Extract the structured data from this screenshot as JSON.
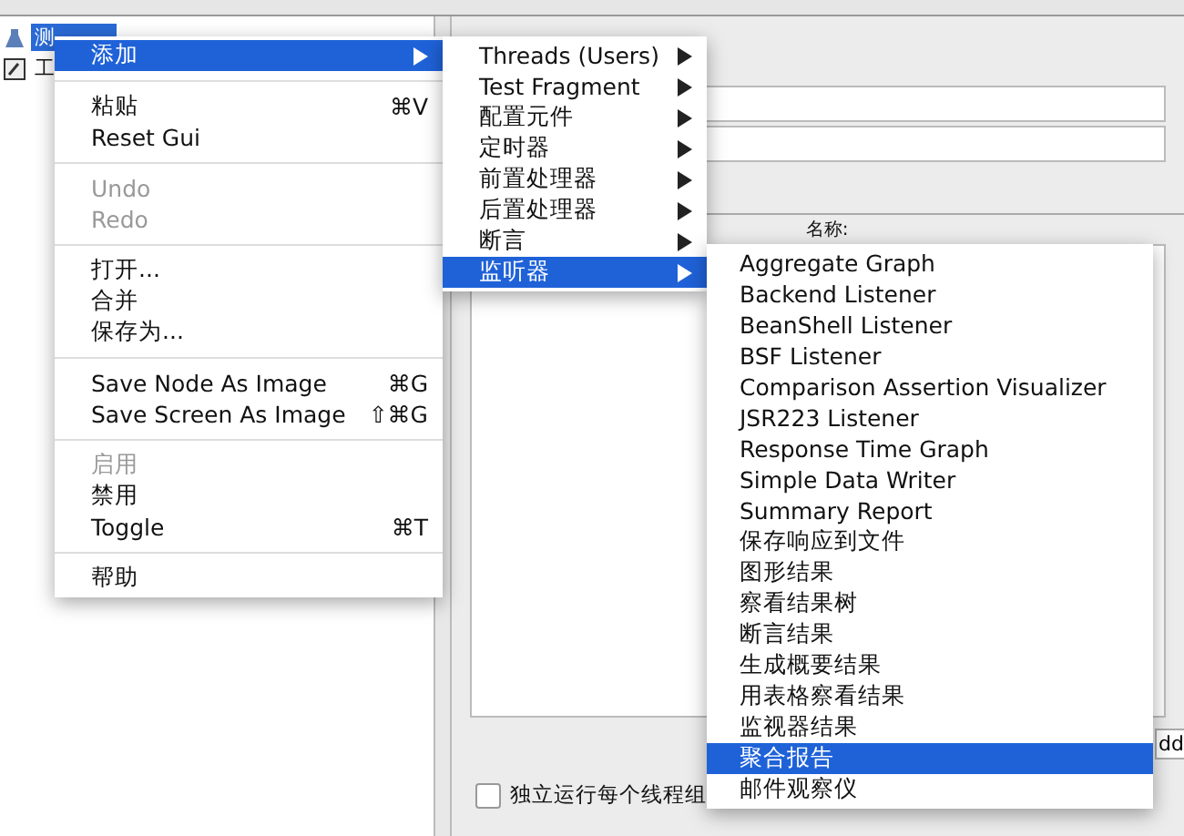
{
  "tree": [
    {
      "label": "测",
      "selected": true
    },
    {
      "label": "工",
      "selected": false
    }
  ],
  "panel": {
    "name_label": "名称:",
    "checkbox": {
      "label": "独立运行每个线程组",
      "checked": false
    },
    "button_fragment": "dd"
  },
  "context_menu": {
    "groups": [
      [
        {
          "label": "添加",
          "disabled": false,
          "selected": true,
          "submenu": true
        }
      ],
      [
        {
          "label": "粘贴",
          "shortcut": "⌘V",
          "disabled": false,
          "selected": false,
          "submenu": false
        },
        {
          "label": "Reset Gui",
          "disabled": false,
          "selected": false,
          "submenu": false
        }
      ],
      [
        {
          "label": "Undo",
          "disabled": true,
          "selected": false,
          "submenu": false
        },
        {
          "label": "Redo",
          "disabled": true,
          "selected": false,
          "submenu": false
        }
      ],
      [
        {
          "label": "打开...",
          "disabled": false,
          "selected": false,
          "submenu": false
        },
        {
          "label": "合并",
          "disabled": false,
          "selected": false,
          "submenu": false
        },
        {
          "label": "保存为...",
          "disabled": false,
          "selected": false,
          "submenu": false
        }
      ],
      [
        {
          "label": "Save Node As Image",
          "shortcut": "⌘G",
          "disabled": false,
          "selected": false,
          "submenu": false
        },
        {
          "label": "Save Screen As Image",
          "shortcut": "⇧⌘G",
          "disabled": false,
          "selected": false,
          "submenu": false
        }
      ],
      [
        {
          "label": "启用",
          "disabled": true,
          "selected": false,
          "submenu": false
        },
        {
          "label": "禁用",
          "disabled": false,
          "selected": false,
          "submenu": false
        },
        {
          "label": "Toggle",
          "shortcut": "⌘T",
          "disabled": false,
          "selected": false,
          "submenu": false
        }
      ],
      [
        {
          "label": "帮助",
          "disabled": false,
          "selected": false,
          "submenu": false
        }
      ]
    ]
  },
  "add_submenu": [
    {
      "label": "Threads (Users)",
      "selected": false
    },
    {
      "label": "Test Fragment",
      "selected": false
    },
    {
      "label": "配置元件",
      "selected": false
    },
    {
      "label": "定时器",
      "selected": false
    },
    {
      "label": "前置处理器",
      "selected": false
    },
    {
      "label": "后置处理器",
      "selected": false
    },
    {
      "label": "断言",
      "selected": false
    },
    {
      "label": "监听器",
      "selected": true
    }
  ],
  "listener_submenu": [
    {
      "label": "Aggregate Graph",
      "selected": false
    },
    {
      "label": "Backend Listener",
      "selected": false
    },
    {
      "label": "BeanShell Listener",
      "selected": false
    },
    {
      "label": "BSF Listener",
      "selected": false
    },
    {
      "label": "Comparison Assertion Visualizer",
      "selected": false
    },
    {
      "label": "JSR223 Listener",
      "selected": false
    },
    {
      "label": "Response Time Graph",
      "selected": false
    },
    {
      "label": "Simple Data Writer",
      "selected": false
    },
    {
      "label": "Summary Report",
      "selected": false
    },
    {
      "label": "保存响应到文件",
      "selected": false
    },
    {
      "label": "图形结果",
      "selected": false
    },
    {
      "label": "察看结果树",
      "selected": false
    },
    {
      "label": "断言结果",
      "selected": false
    },
    {
      "label": "生成概要结果",
      "selected": false
    },
    {
      "label": "用表格察看结果",
      "selected": false
    },
    {
      "label": "监视器结果",
      "selected": false
    },
    {
      "label": "聚合报告",
      "selected": true
    },
    {
      "label": "邮件观察仪",
      "selected": false
    }
  ]
}
